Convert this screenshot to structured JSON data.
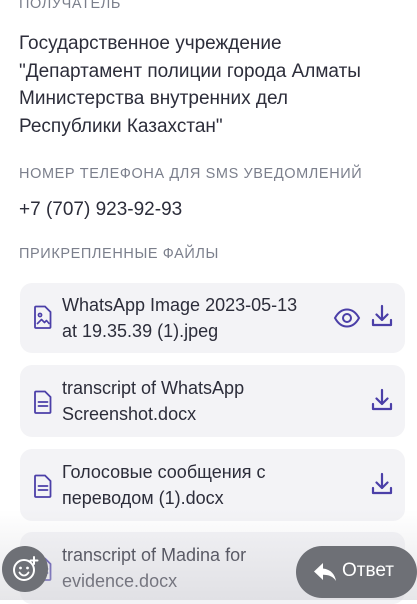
{
  "recipient": {
    "label": "ПОЛУЧАТЕЛЬ",
    "lines": [
      "Государственное учреждение",
      "\"Департамент полиции города Алматы",
      "Министерства внутренних дел",
      "Республики Казахстан\""
    ]
  },
  "phone": {
    "label": "НОМЕР ТЕЛЕФОНА ДЛЯ SMS УВЕДОМЛЕНИЙ",
    "value": "+7 (707) 923-92-93"
  },
  "attachments": {
    "label": "ПРИКРЕПЛЕННЫЕ ФАЙЛЫ",
    "files": [
      {
        "line1": "WhatsApp Image 2023-05-13",
        "line2": "at 19.35.39 (1).jpeg",
        "icon": "image-file-icon",
        "actions": [
          "view-icon",
          "download-icon"
        ]
      },
      {
        "line1": "transcript of WhatsApp",
        "line2": "Screenshot.docx",
        "icon": "document-file-icon",
        "actions": [
          "download-icon"
        ]
      },
      {
        "line1": "Голосовые сообщения с",
        "line2": "переводом (1).docx",
        "icon": "document-file-icon",
        "actions": [
          "download-icon"
        ]
      },
      {
        "line1": "transcript of Madina for",
        "line2": "evidence.docx",
        "icon": "document-file-icon",
        "actions": []
      }
    ]
  },
  "footer": {
    "emoji_icon": "emoji-add-icon",
    "reply_label": "Ответ",
    "reply_icon": "reply-arrow-icon"
  },
  "colors": {
    "accent": "#4b3fa8",
    "label_gray": "#7b7f8c",
    "card_bg": "#f3f3f6",
    "overlay_button": "#6e7076"
  }
}
